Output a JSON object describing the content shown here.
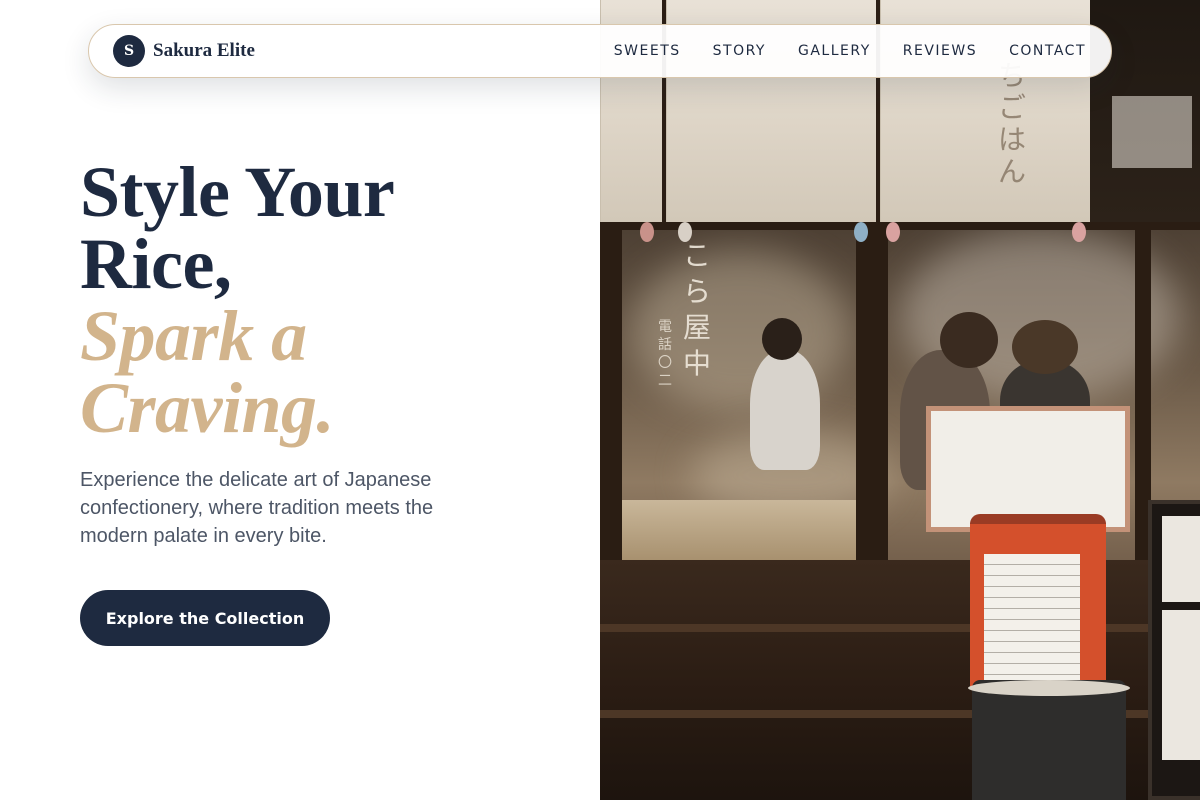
{
  "brand": {
    "logo_letter": "S",
    "name": "Sakura Elite"
  },
  "nav": {
    "items": [
      {
        "label": "SWEETS"
      },
      {
        "label": "STORY"
      },
      {
        "label": "GALLERY"
      },
      {
        "label": "REVIEWS"
      },
      {
        "label": "CONTACT"
      }
    ]
  },
  "hero": {
    "headline_line1": "Style Your",
    "headline_line2": "Rice,",
    "accent_line1": "Spark a",
    "accent_line2": "Craving.",
    "description": "Experience the delicate art of Japanese confectionery, where tradition meets the modern palate in every bite.",
    "cta_label": "Explore the Collection"
  },
  "photo": {
    "noren_text": "ちごはん",
    "window_text": "こら屋中",
    "window_small_text": "電話〇二"
  },
  "colors": {
    "navy": "#1e2a40",
    "gold": "#d2b48c",
    "body_text": "#4d5666"
  }
}
